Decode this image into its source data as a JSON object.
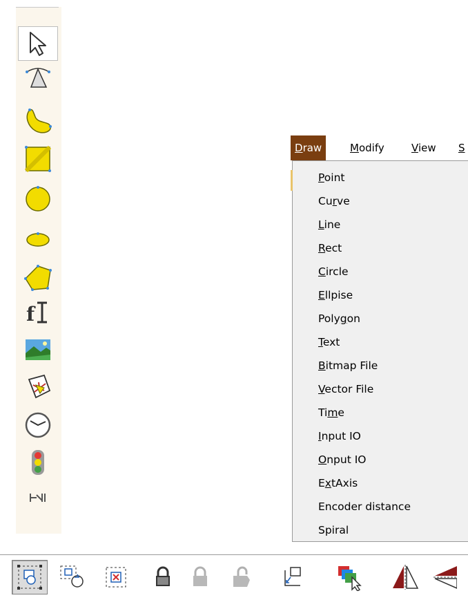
{
  "left_toolbar": {
    "tools": [
      {
        "name": "select-arrow-icon"
      },
      {
        "name": "pen-curve-icon"
      },
      {
        "name": "freeform-shape-icon"
      },
      {
        "name": "rectangle-icon"
      },
      {
        "name": "circle-icon"
      },
      {
        "name": "ellipse-icon"
      },
      {
        "name": "polygon-icon"
      },
      {
        "name": "text-tool-icon"
      },
      {
        "name": "bitmap-image-icon"
      },
      {
        "name": "vector-file-icon"
      },
      {
        "name": "clock-time-icon"
      },
      {
        "name": "traffic-light-io-icon"
      },
      {
        "name": "axis-distance-icon"
      }
    ]
  },
  "menu_bar": {
    "items": [
      {
        "prefix": "",
        "accel": "D",
        "rest": "raw"
      },
      {
        "prefix": "",
        "accel": "M",
        "rest": "odify"
      },
      {
        "prefix": "",
        "accel": "V",
        "rest": "iew"
      },
      {
        "prefix": "",
        "accel": "S",
        "rest": ""
      }
    ]
  },
  "draw_menu": {
    "items": [
      {
        "before": "",
        "accel": "P",
        "after": "oint"
      },
      {
        "before": "Cu",
        "accel": "r",
        "after": "ve"
      },
      {
        "before": "",
        "accel": "L",
        "after": "ine"
      },
      {
        "before": "",
        "accel": "R",
        "after": "ect"
      },
      {
        "before": "",
        "accel": "C",
        "after": "ircle"
      },
      {
        "before": "",
        "accel": "E",
        "after": "llpise"
      },
      {
        "before": "Poly",
        "accel": "g",
        "after": "on"
      },
      {
        "before": "",
        "accel": "T",
        "after": "ext"
      },
      {
        "before": "",
        "accel": "B",
        "after": "itmap File"
      },
      {
        "before": "",
        "accel": "V",
        "after": "ector File"
      },
      {
        "before": "Ti",
        "accel": "m",
        "after": "e"
      },
      {
        "before": "",
        "accel": "I",
        "after": "nput IO"
      },
      {
        "before": "",
        "accel": "O",
        "after": "nput IO"
      },
      {
        "before": "E",
        "accel": "x",
        "after": "tAxis"
      },
      {
        "before": "Encoder distance",
        "accel": "",
        "after": ""
      },
      {
        "before": "Spiral",
        "accel": "",
        "after": ""
      }
    ]
  },
  "bottom_toolbar": {
    "tools": [
      {
        "name": "group-select-icon",
        "state": "pressed"
      },
      {
        "name": "rotate-select-icon",
        "state": "raised"
      },
      {
        "name": "delete-select-icon",
        "state": "raised"
      },
      {
        "name": "lock-icon",
        "state": "raised"
      },
      {
        "name": "lock-disabled-icon",
        "state": "raised"
      },
      {
        "name": "unlock-disabled-icon",
        "state": "raised"
      },
      {
        "name": "set-origin-icon",
        "state": "raised"
      },
      {
        "name": "layer-order-icon",
        "state": "raised"
      },
      {
        "name": "mirror-horizontal-icon",
        "state": "raised"
      },
      {
        "name": "mirror-vertical-icon",
        "state": "raised"
      }
    ]
  },
  "colors": {
    "shape_fill": "#f2dc00",
    "shape_stroke": "#6b6b00",
    "menu_active_bg": "#7a3e10",
    "menu_bg": "#f0f0f0",
    "toolbar_bg": "#fbf6ec"
  }
}
